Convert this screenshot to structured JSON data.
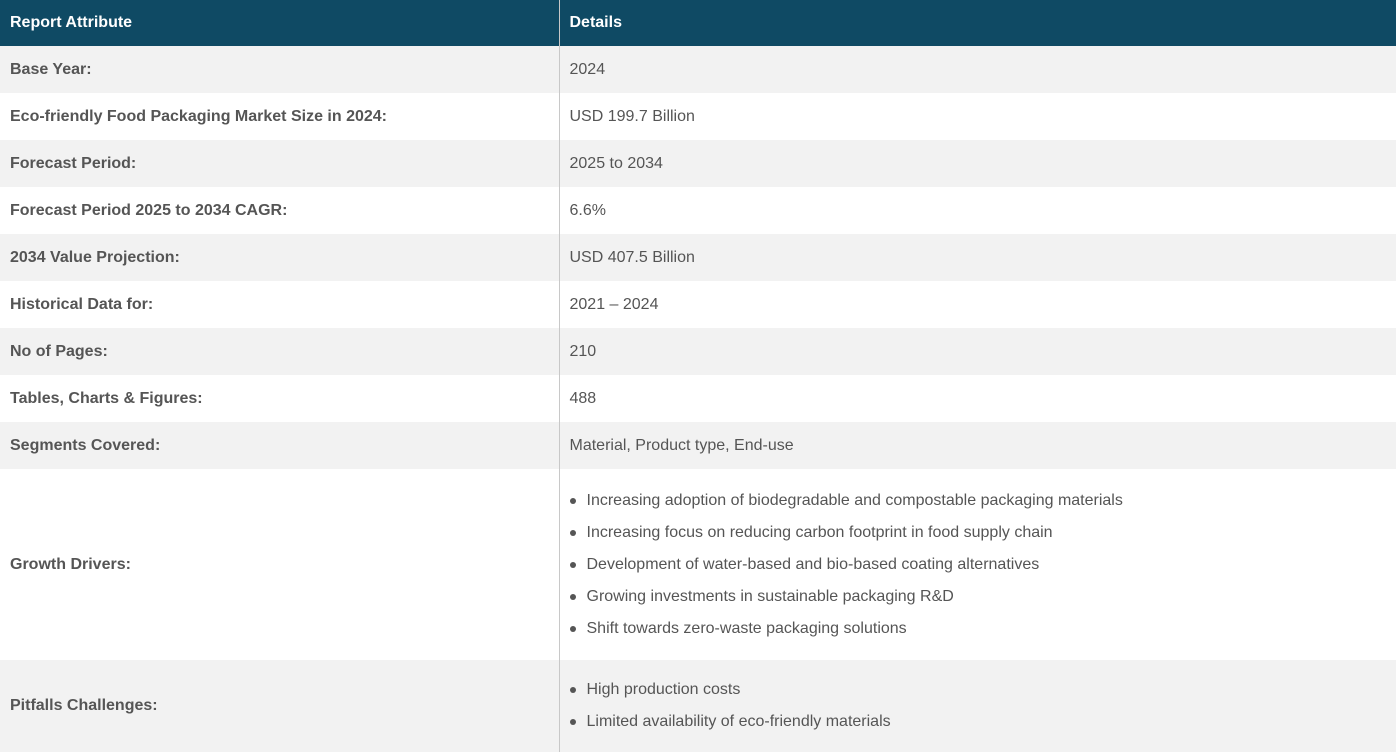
{
  "header": {
    "attribute": "Report Attribute",
    "details": "Details"
  },
  "rows": [
    {
      "label": "Base Year:",
      "value": "2024"
    },
    {
      "label": "Eco-friendly Food Packaging Market Size in 2024:",
      "value": "USD 199.7 Billion"
    },
    {
      "label": "Forecast Period:",
      "value": "2025 to 2034"
    },
    {
      "label": "Forecast Period 2025 to 2034 CAGR:",
      "value": "6.6%"
    },
    {
      "label": "2034 Value Projection:",
      "value": "USD 407.5 Billion"
    },
    {
      "label": "Historical Data for:",
      "value": "2021 – 2024"
    },
    {
      "label": "No of Pages:",
      "value": "210"
    },
    {
      "label": "Tables, Charts & Figures:",
      "value": "488"
    },
    {
      "label": "Segments Covered:",
      "value": "Material, Product type, End-use"
    }
  ],
  "growth_drivers": {
    "label": "Growth Drivers:",
    "items": [
      "Increasing adoption of biodegradable and compostable packaging materials",
      "Increasing focus on reducing carbon footprint in food supply chain",
      "Development of water-based and bio-based coating alternatives",
      "Growing investments in sustainable packaging R&D",
      "Shift towards zero-waste packaging solutions"
    ]
  },
  "pitfalls": {
    "label": "Pitfalls Challenges:",
    "items": [
      "High production costs",
      "Limited availability of eco-friendly materials"
    ]
  },
  "colors": {
    "header_bg": "#0f4a64",
    "header_text": "#ffffff",
    "row_alt_bg": "#f2f2f2",
    "text": "#555555"
  }
}
